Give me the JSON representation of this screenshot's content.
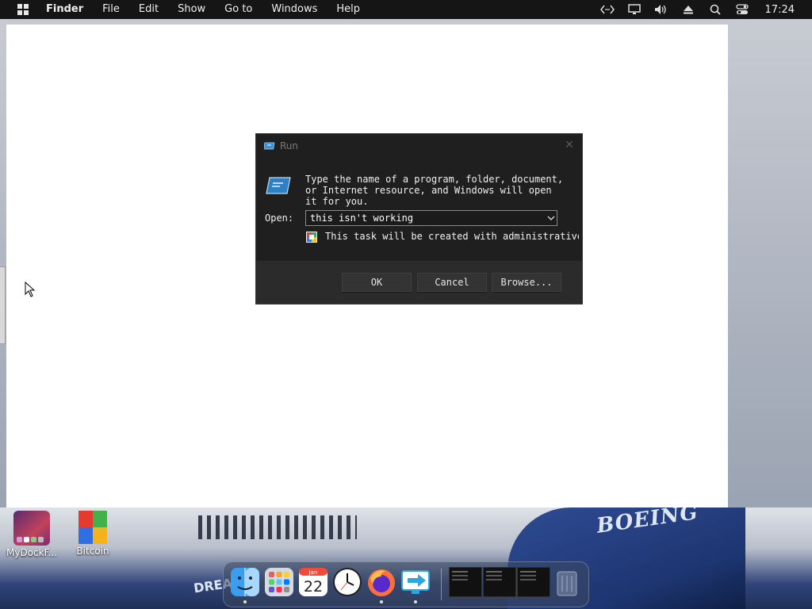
{
  "menubar": {
    "items": [
      "Finder",
      "File",
      "Edit",
      "Show",
      "Go to",
      "Windows",
      "Help"
    ],
    "clock": "17:24",
    "tray_icons": [
      "code-icon",
      "display-icon",
      "volume-icon",
      "eject-icon",
      "search-icon",
      "control-center-icon"
    ]
  },
  "run_dialog": {
    "title": "Run",
    "description": "Type the name of a program, folder, document,\nor Internet resource, and Windows will open\nit for you.",
    "open_label": "Open:",
    "input_value": "this isn't working",
    "admin_note": "This task will be created with administrative privileges.",
    "buttons": {
      "ok": "OK",
      "cancel": "Cancel",
      "browse": "Browse..."
    }
  },
  "desktop": {
    "icons": [
      {
        "label": "MyDockF..."
      },
      {
        "label": "Bitcoin"
      }
    ],
    "wallpaper_text": {
      "brand": "BOEING",
      "model": "DREAM"
    }
  },
  "dock": {
    "calendar_month": "Jan",
    "calendar_day": "22",
    "apps": [
      "finder-icon",
      "launchpad-icon",
      "calendar-icon",
      "clock-icon",
      "firefox-icon",
      "remote-desktop-icon"
    ],
    "windows": [
      "window-thumb-1",
      "window-thumb-2",
      "window-thumb-3"
    ],
    "trash": "trash-icon"
  },
  "colors": {
    "dialog_bg": "#1f1f1f",
    "dialog_footer": "#2b2b2b",
    "menubar_bg": "#151515"
  }
}
